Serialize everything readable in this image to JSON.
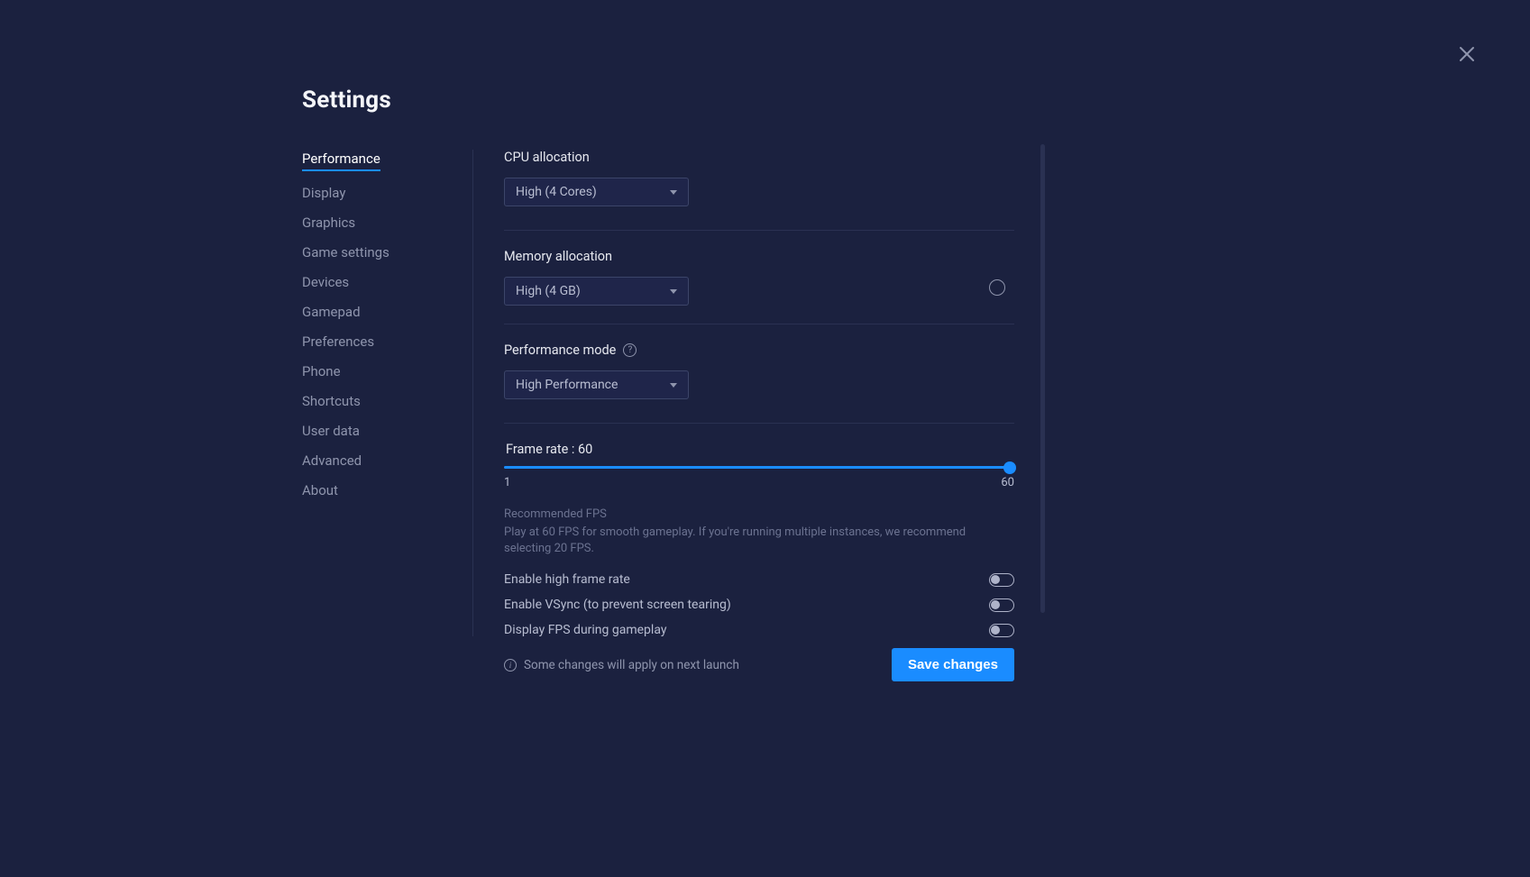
{
  "title": "Settings",
  "sidebar": {
    "items": [
      {
        "label": "Performance",
        "active": true
      },
      {
        "label": "Display"
      },
      {
        "label": "Graphics"
      },
      {
        "label": "Game settings"
      },
      {
        "label": "Devices"
      },
      {
        "label": "Gamepad"
      },
      {
        "label": "Preferences"
      },
      {
        "label": "Phone"
      },
      {
        "label": "Shortcuts"
      },
      {
        "label": "User data"
      },
      {
        "label": "Advanced"
      },
      {
        "label": "About"
      }
    ]
  },
  "cpu": {
    "label": "CPU allocation",
    "value": "High (4 Cores)"
  },
  "memory": {
    "label": "Memory allocation",
    "value": "High (4 GB)"
  },
  "perf_mode": {
    "label": "Performance mode",
    "value": "High Performance"
  },
  "frame_rate": {
    "title_prefix": "Frame rate : ",
    "value": "60",
    "min": "1",
    "max": "60",
    "hint_title": "Recommended FPS",
    "hint_body": "Play at 60 FPS for smooth gameplay. If you're running multiple instances, we recommend selecting 20 FPS."
  },
  "toggles": {
    "high_fps": "Enable high frame rate",
    "vsync": "Enable VSync (to prevent screen tearing)",
    "display_fps": "Display FPS during gameplay"
  },
  "footer": {
    "note": "Some changes will apply on next launch",
    "save": "Save changes"
  }
}
